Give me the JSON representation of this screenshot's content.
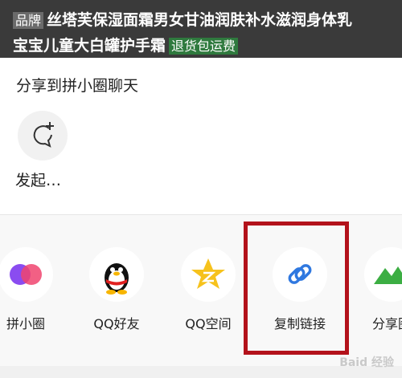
{
  "product": {
    "brand_badge": "品牌",
    "title_line1": "丝塔芙保湿面霜男女甘油润肤补水滋润身体乳",
    "title_line2": "宝宝儿童大白罐护手霜",
    "refund_badge": "退货包运费"
  },
  "share_sheet": {
    "title": "分享到拼小圈聊天",
    "start_chat_label": "发起…",
    "apps": [
      {
        "label": "拼小圈",
        "icon": "pinxiaoquan-icon"
      },
      {
        "label": "QQ好友",
        "icon": "qq-penguin-icon"
      },
      {
        "label": "QQ空间",
        "icon": "qzone-star-icon"
      },
      {
        "label": "复制链接",
        "icon": "link-icon"
      },
      {
        "label": "分享图",
        "icon": "image-mountain-icon"
      }
    ]
  },
  "watermark": "Baid 经验",
  "colors": {
    "highlight": "#b3121b",
    "link_blue": "#2f78e0",
    "qzone_yellow": "#f6c21c",
    "mountain_green": "#3cae43"
  }
}
